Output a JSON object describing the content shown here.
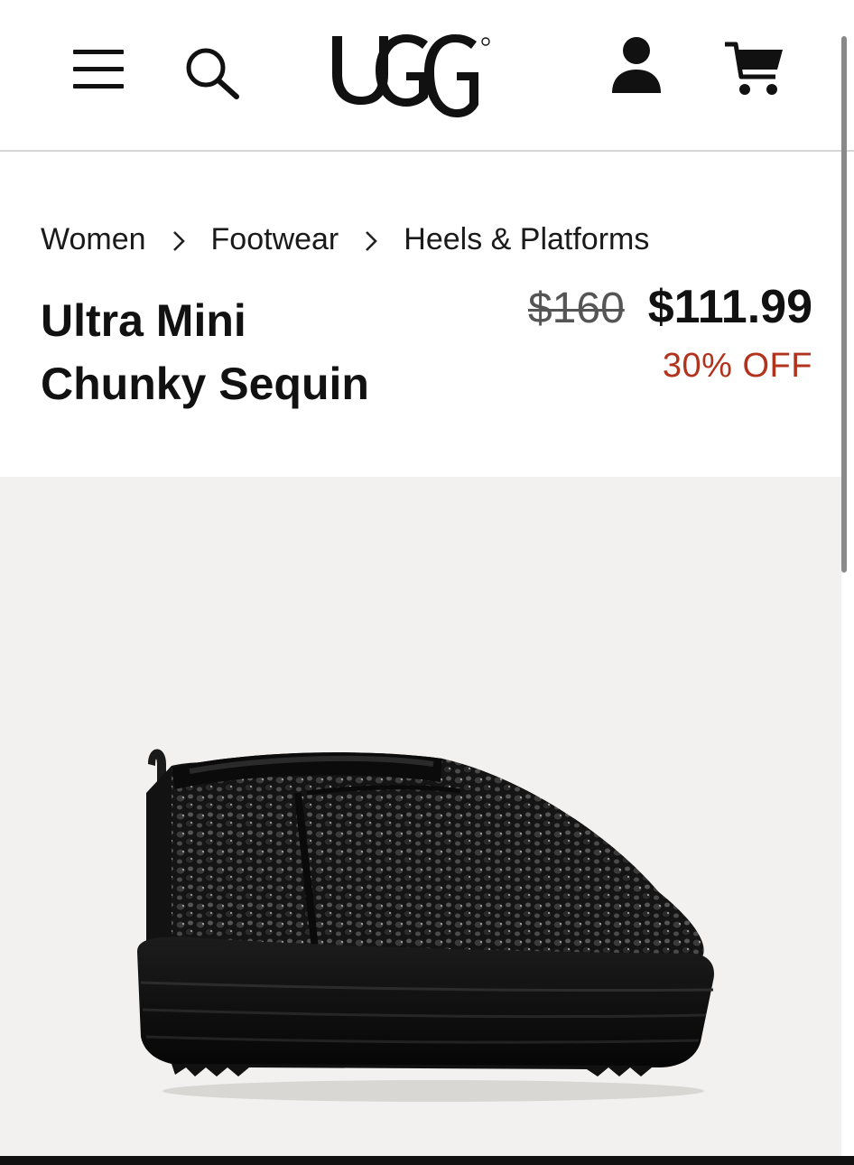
{
  "header": {
    "brand": "UGG",
    "icons": [
      "menu-icon",
      "search-icon",
      "account-icon",
      "cart-icon"
    ]
  },
  "breadcrumb": {
    "items": [
      "Women",
      "Footwear",
      "Heels & Platforms"
    ],
    "separator_icon": "chevron-right-icon"
  },
  "product": {
    "title_line1": "Ultra Mini",
    "title_line2": "Chunky Sequin",
    "original_price": "$160",
    "sale_price": "$111.99",
    "discount": "30% OFF",
    "image": "black sequin platform boot"
  },
  "colors": {
    "discount": "#b2331c",
    "image_background": "#f2f1ef",
    "divider": "#d6d6d6"
  }
}
